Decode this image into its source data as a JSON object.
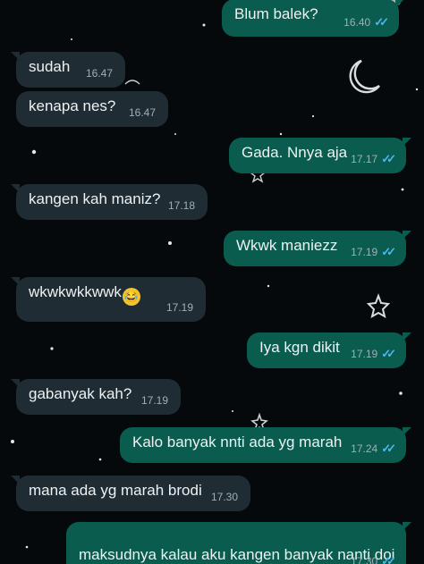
{
  "messages": [
    {
      "side": "out",
      "text": "Blum balek?",
      "time": "16.40",
      "read": true
    },
    {
      "side": "in",
      "text": "sudah",
      "time": "16.47"
    },
    {
      "side": "in",
      "text": "kenapa nes?",
      "time": "16.47"
    },
    {
      "side": "out",
      "text": "Gada. Nnya aja",
      "time": "17.17",
      "read": true
    },
    {
      "side": "in",
      "text": "kangen kah maniz?",
      "time": "17.18"
    },
    {
      "side": "out",
      "text": "Wkwk maniezz",
      "time": "17.19",
      "read": true
    },
    {
      "side": "in",
      "text": "wkwkwkkwwk",
      "emoji": "laughing-with-tears",
      "time": "17.19"
    },
    {
      "side": "out",
      "text": "Iya kgn dikit",
      "time": "17.19",
      "read": true
    },
    {
      "side": "in",
      "text": "gabanyak kah?",
      "time": "17.19"
    },
    {
      "side": "out",
      "text": "Kalo banyak nnti ada yg marah",
      "time": "17.24",
      "read": true
    },
    {
      "side": "in",
      "text": "mana ada yg marah brodi",
      "time": "17.30"
    },
    {
      "side": "out",
      "text": "maksudnya kalau aku kangen banyak nanti doi\naku marahhh",
      "time": "17.30",
      "read": true
    }
  ],
  "icons": {
    "read_receipt": "double-check-icon",
    "emoji": "laughing-face-emoji",
    "wallpaper": [
      "crescent-moon-icon",
      "star-icon"
    ]
  },
  "colors": {
    "background": "#06090c",
    "incoming": "#1f2c33",
    "outgoing": "#0a5c4f",
    "read_ticks": "#4fb6ec",
    "time": "#9db0b5"
  }
}
